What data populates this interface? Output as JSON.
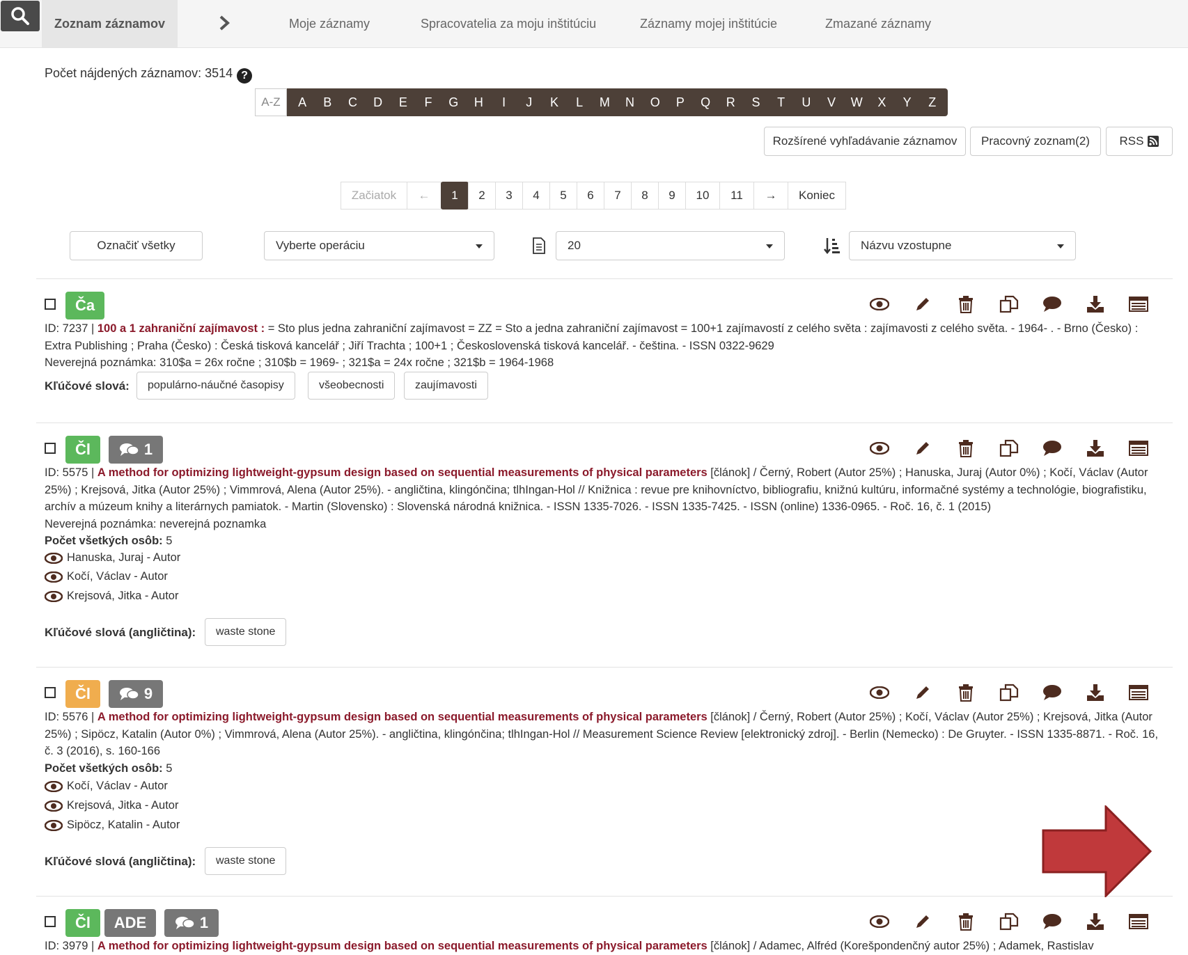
{
  "nav": {
    "active_tab": "Zoznam záznamov",
    "links": [
      "Moje záznamy",
      "Spracovatelia za moju inštitúciu",
      "Záznamy mojej inštitúcie",
      "Zmazané záznamy"
    ]
  },
  "count_label": "Počet nájdených záznamov: 3514",
  "az": {
    "first": "A-Z",
    "letters": [
      "A",
      "B",
      "C",
      "D",
      "E",
      "F",
      "G",
      "H",
      "I",
      "J",
      "K",
      "L",
      "M",
      "N",
      "O",
      "P",
      "Q",
      "R",
      "S",
      "T",
      "U",
      "V",
      "W",
      "X",
      "Y",
      "Z"
    ]
  },
  "buttons": {
    "advanced": "Rozšírené vyhľadávanie záznamov",
    "worklist": "Pracovný zoznam(2)",
    "rss": "RSS"
  },
  "pager": {
    "start": "Začiatok",
    "prev": "←",
    "pages": [
      "1",
      "2",
      "3",
      "4",
      "5",
      "6",
      "7",
      "8",
      "9",
      "10",
      "11"
    ],
    "next": "→",
    "end": "Koniec",
    "current": "1"
  },
  "controls": {
    "select_all": "Označiť všetky",
    "operation": "Vyberte operáciu",
    "per_page": "20",
    "sort": "Názvu vzostupne"
  },
  "records": [
    {
      "badges": [
        {
          "text": "Ča",
          "color": "green"
        }
      ],
      "id_prefix": "ID: 7237 | ",
      "title": "100 a 1 zahraniční zajímavost :",
      "rest": " = Sto plus jedna zahraniční zajímavost = ZZ = Sto a jedna zahraniční zajímavost = 100+1 zajímavostí z celého světa : zajímavosti z celého světa. - 1964- . - Brno (Česko) : Extra Publishing ; Praha (Česko) : Česká tisková kancelář ; Jiří Trachta ; 100+1 ; Československá tisková kancelář. - čeština. - ISSN 0322-9629",
      "note": "Neverejná poznámka: 310$a = 26x ročne ; 310$b = 1969- ; 321$a = 24x ročne ; 321$b = 1964-1968",
      "keywords_label": "Kľúčové slová:",
      "keywords": [
        "populárno-náučné časopisy",
        "všeobecnosti",
        "zaujímavosti"
      ]
    },
    {
      "badges": [
        {
          "text": "Čl",
          "color": "green"
        },
        {
          "text": "1",
          "color": "dark",
          "comment": true
        }
      ],
      "id_prefix": "ID: 5575 | ",
      "title": "A method for optimizing lightweight-gypsum design based on sequential measurements of physical parameters",
      "rest": " [článok] / Černý, Robert (Autor 25%) ; Hanuska, Juraj (Autor 0%) ; Kočí, Václav (Autor 25%) ; Krejsová, Jitka (Autor 25%) ; Vimmrová, Alena (Autor 25%). - angličtina, klingónčina; tlhIngan-Hol // Knižnica : revue pre knihovníctvo, bibliografiu, knižnú kultúru, informačné systémy a technológie, biografistiku, archív a múzeum knihy a literárnych pamiatok. - Martin (Slovensko) : Slovenská národná knižnica. - ISSN 1335-7026. - ISSN 1335-7425. - ISSN (online) 1336-0965. - Roč. 16, č. 1 (2015)",
      "note": "Neverejná poznámka: neverejná poznamka",
      "persons_label": "Počet všetkých osôb:",
      "persons_count": "5",
      "persons": [
        "Hanuska, Juraj - Autor",
        "Kočí, Václav - Autor",
        "Krejsová, Jitka - Autor"
      ],
      "keywords_label": "Kľúčové slová (angličtina):",
      "keywords": [
        "waste stone"
      ]
    },
    {
      "badges": [
        {
          "text": "Čl",
          "color": "orange"
        },
        {
          "text": "9",
          "color": "dark",
          "comment": true
        }
      ],
      "id_prefix": "ID: 5576 | ",
      "title": "A method for optimizing lightweight-gypsum design based on sequential measurements of physical parameters",
      "rest": " [článok] / Černý, Robert (Autor 25%) ; Kočí, Václav (Autor 25%) ; Krejsová, Jitka (Autor 25%) ; Sipöcz, Katalin (Autor 0%) ; Vimmrová, Alena (Autor 25%). - angličtina, klingónčina; tlhIngan-Hol // Measurement Science Review [elektronický zdroj]. - Berlin (Nemecko) : De Gruyter. - ISSN 1335-8871. - Roč. 16, č. 3 (2016), s. 160-166",
      "persons_label": "Počet všetkých osôb:",
      "persons_count": "5",
      "persons": [
        "Kočí, Václav - Autor",
        "Krejsová, Jitka - Autor",
        "Sipöcz, Katalin - Autor"
      ],
      "keywords_label": "Kľúčové slová (angličtina):",
      "keywords": [
        "waste stone"
      ]
    },
    {
      "badges": [
        {
          "text": "Čl",
          "color": "green"
        },
        {
          "text": "ADE",
          "color": "dark"
        },
        {
          "text": "1",
          "color": "dark",
          "comment": true
        }
      ],
      "id_prefix": "ID: 3979 | ",
      "title": "A method for optimizing lightweight-gypsum design based on sequential measurements of physical parameters",
      "rest": " [článok] / Adamec, Alfréd (Korešpondenčný autor 25%) ; Adamek, Rastislav"
    }
  ],
  "record_actions": [
    "eye-icon",
    "pencil-icon",
    "trash-icon",
    "copy-icon",
    "comment-icon",
    "download-icon",
    "list-icon"
  ],
  "colors": {
    "brand": "#4d4038",
    "title": "#8b1a2b",
    "green": "#5cb85c",
    "orange": "#f0ad4e",
    "dark": "#777777",
    "arrow": "#c0393b"
  }
}
